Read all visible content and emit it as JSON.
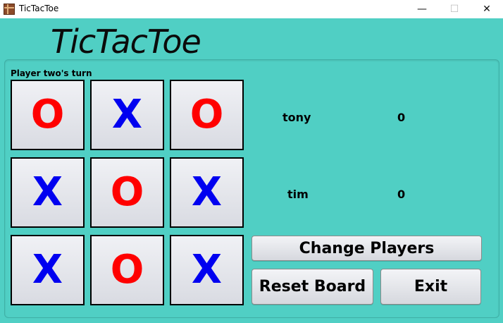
{
  "window": {
    "title": "TicTacToe",
    "minimize": "—",
    "maximize": "☐",
    "close": "✕"
  },
  "app": {
    "logo": "TicTacToe",
    "status": "Player two's turn"
  },
  "board": [
    "O",
    "X",
    "O",
    "X",
    "O",
    "X",
    "X",
    "O",
    "X"
  ],
  "players": [
    {
      "name": "tony",
      "score": "0"
    },
    {
      "name": "tim",
      "score": "0"
    }
  ],
  "buttons": {
    "change_players": "Change Players",
    "reset_board": "Reset Board",
    "exit": "Exit"
  },
  "colors": {
    "background": "#50cfc4",
    "o_mark": "#ff0000",
    "x_mark": "#0000f0"
  },
  "icons": {
    "app": "tictactoe-app-icon"
  }
}
